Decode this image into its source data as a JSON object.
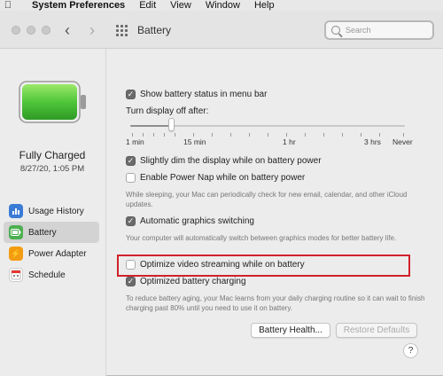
{
  "menubar": {
    "apple": "",
    "items": [
      "System Preferences",
      "Edit",
      "View",
      "Window",
      "Help"
    ]
  },
  "window": {
    "title": "Battery",
    "search_placeholder": "Search"
  },
  "sidebar": {
    "status": "Fully Charged",
    "date": "8/27/20, 1:05 PM",
    "items": [
      {
        "label": "Usage History",
        "icon": "bar-chart-icon",
        "color": "#3a7bd5",
        "active": false
      },
      {
        "label": "Battery",
        "icon": "battery-icon",
        "color": "#4caf50",
        "active": true
      },
      {
        "label": "Power Adapter",
        "icon": "lightning-icon",
        "color": "#f39c12",
        "active": false
      },
      {
        "label": "Schedule",
        "icon": "calendar-icon",
        "color": "#e53935",
        "active": false
      }
    ]
  },
  "main": {
    "show_status": {
      "label": "Show battery status in menu bar",
      "checked": true
    },
    "turn_off_label": "Turn display off after:",
    "slider_value": "15 min",
    "slider_labels": [
      "1 min",
      "15 min",
      "1 hr",
      "3 hrs",
      "Never"
    ],
    "dim": {
      "label": "Slightly dim the display while on battery power",
      "checked": true
    },
    "power_nap": {
      "label": "Enable Power Nap while on battery power",
      "checked": false
    },
    "power_nap_note": "While sleeping, your Mac can periodically check for new email, calendar, and other iCloud updates.",
    "graphics": {
      "label": "Automatic graphics switching",
      "checked": true
    },
    "graphics_note": "Your computer will automatically switch between graphics modes for better battery life.",
    "video": {
      "label": "Optimize video streaming while on battery",
      "checked": false
    },
    "optimized_charging": {
      "label": "Optimized battery charging",
      "checked": true
    },
    "optimized_note": "To reduce battery aging, your Mac learns from your daily charging routine so it can wait to finish charging past 80% until you need to use it on battery.",
    "battery_health_button": "Battery Health...",
    "restore_button": "Restore Defaults",
    "help": "?"
  },
  "colors": {
    "battery_green": "#4fc63b",
    "highlight": "#d1212b"
  }
}
